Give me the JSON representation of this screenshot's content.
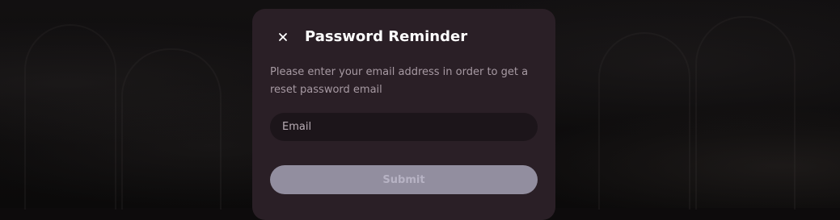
{
  "modal": {
    "title": "Password Reminder",
    "close_icon": "close-icon",
    "description": "Please enter your email address in order to get a reset password email",
    "email": {
      "placeholder": "Email",
      "value": ""
    },
    "submit_label": "Submit"
  },
  "colors": {
    "modal_background": "#2a1f26",
    "input_background": "#1c151a",
    "submit_background": "#928e9f",
    "title_text": "#ffffff",
    "description_text": "#a79aa3"
  }
}
